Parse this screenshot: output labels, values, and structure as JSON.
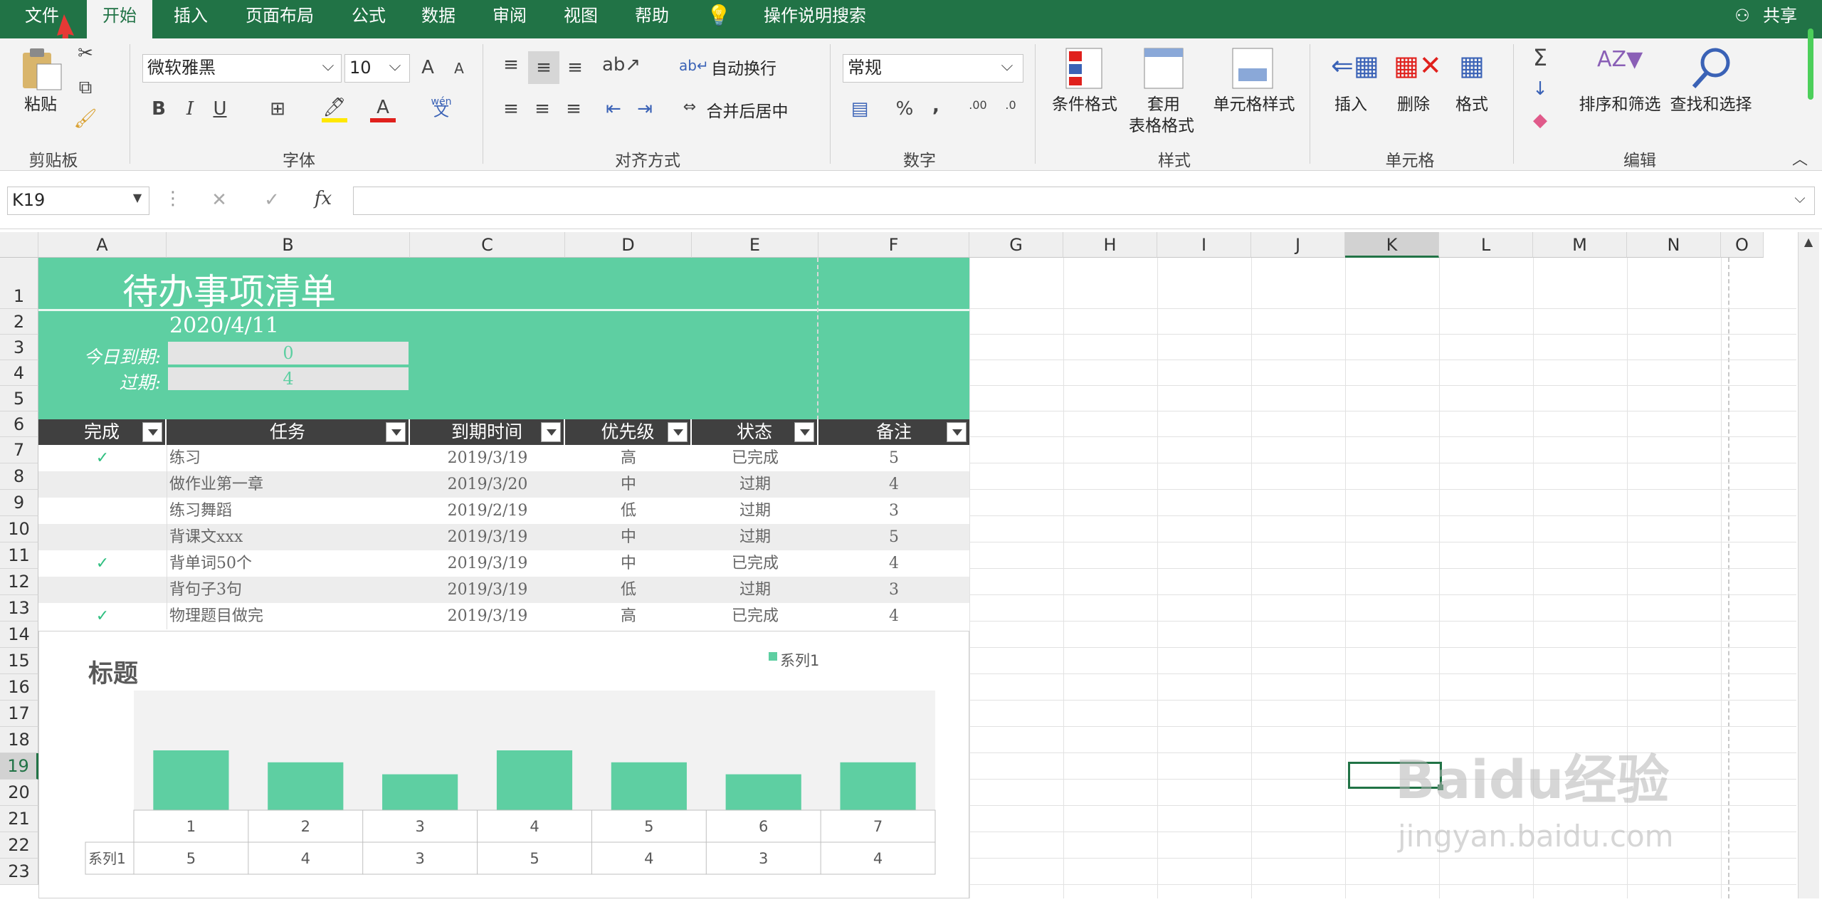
{
  "menu": {
    "file": "文件",
    "home": "开始",
    "insert": "插入",
    "layout": "页面布局",
    "formulas": "公式",
    "data": "数据",
    "review": "审阅",
    "view": "视图",
    "help": "帮助",
    "search": "操作说明搜索",
    "share": "共享"
  },
  "ribbon": {
    "clipboard": {
      "paste": "粘贴",
      "label": "剪贴板"
    },
    "font": {
      "name": "微软雅黑",
      "size": "10",
      "bold": "B",
      "italic": "I",
      "underline": "U",
      "grow": "A",
      "shrink": "A",
      "phonetic_top": "wén",
      "phonetic": "文",
      "label": "字体"
    },
    "alignment": {
      "wrap": "自动换行",
      "merge": "合并后居中",
      "label": "对齐方式"
    },
    "number": {
      "format": "常规",
      "percent": "%",
      "comma": ",",
      "label": "数字"
    },
    "styles": {
      "conditional": "条件格式",
      "table1": "套用",
      "table2": "表格格式",
      "cell_styles": "单元格样式",
      "label": "样式"
    },
    "cells": {
      "insert": "插入",
      "delete": "删除",
      "format": "格式",
      "label": "单元格"
    },
    "editing": {
      "sort": "排序和筛选",
      "find": "查找和选择",
      "label": "编辑"
    }
  },
  "formula_bar": {
    "name_box": "K19",
    "fx": "fx",
    "value": ""
  },
  "columns": [
    "A",
    "B",
    "C",
    "D",
    "E",
    "F",
    "G",
    "H",
    "I",
    "J",
    "K",
    "L",
    "M",
    "N",
    "O"
  ],
  "rows": [
    "1",
    "2",
    "3",
    "4",
    "5",
    "6",
    "7",
    "8",
    "9",
    "10",
    "11",
    "12",
    "13",
    "14",
    "15",
    "16",
    "17",
    "18",
    "19",
    "20",
    "21",
    "22",
    "23"
  ],
  "sheet": {
    "title": "待办事项清单",
    "date": "2020/4/11",
    "due_today_label": "今日到期:",
    "due_today_value": "0",
    "overdue_label": "过期:",
    "overdue_value": "4",
    "headers": [
      "完成",
      "任务",
      "到期时间",
      "优先级",
      "状态",
      "备注"
    ],
    "rows": [
      {
        "done": "✓",
        "task": "练习",
        "due": "2019/3/19",
        "priority": "高",
        "status": "已完成",
        "note": "5"
      },
      {
        "done": "",
        "task": "做作业第一章",
        "due": "2019/3/20",
        "priority": "中",
        "status": "过期",
        "note": "4"
      },
      {
        "done": "",
        "task": "练习舞蹈",
        "due": "2019/2/19",
        "priority": "低",
        "status": "过期",
        "note": "3"
      },
      {
        "done": "",
        "task": "背课文xxx",
        "due": "2019/3/19",
        "priority": "中",
        "status": "过期",
        "note": "5"
      },
      {
        "done": "✓",
        "task": "背单词50个",
        "due": "2019/3/19",
        "priority": "中",
        "status": "已完成",
        "note": "4"
      },
      {
        "done": "",
        "task": "背句子3句",
        "due": "2019/3/19",
        "priority": "低",
        "status": "过期",
        "note": "3"
      },
      {
        "done": "✓",
        "task": "物理题目做完",
        "due": "2019/3/19",
        "priority": "高",
        "status": "已完成",
        "note": "4"
      }
    ]
  },
  "colors": {
    "accent": "#217346",
    "teal": "#5ecfa2",
    "header": "#404040"
  },
  "watermark": {
    "brand": "Baidu经验",
    "url": "jingyan.baidu.com"
  },
  "chart_data": {
    "type": "bar",
    "title": "标题",
    "categories": [
      "1",
      "2",
      "3",
      "4",
      "5",
      "6",
      "7"
    ],
    "series": [
      {
        "name": "系列1",
        "values": [
          5,
          4,
          3,
          5,
          4,
          3,
          4
        ]
      }
    ],
    "ylim": [
      0,
      5
    ],
    "legend": "top-right",
    "data_table": true
  }
}
